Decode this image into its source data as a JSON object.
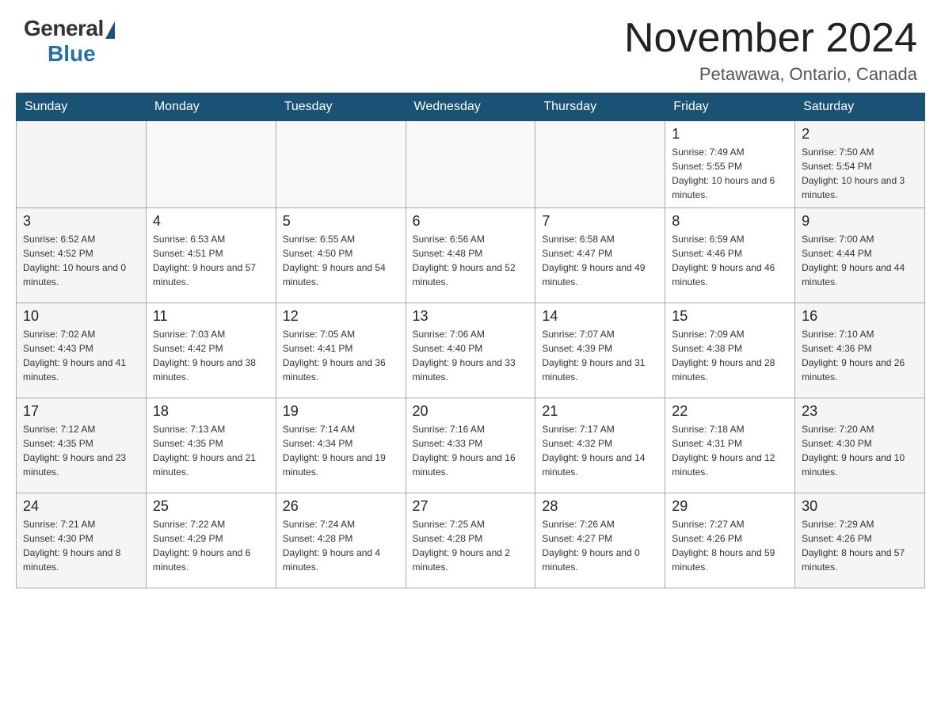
{
  "header": {
    "logo_general": "General",
    "logo_blue": "Blue",
    "month_title": "November 2024",
    "location": "Petawawa, Ontario, Canada"
  },
  "weekdays": [
    "Sunday",
    "Monday",
    "Tuesday",
    "Wednesday",
    "Thursday",
    "Friday",
    "Saturday"
  ],
  "weeks": [
    [
      {
        "day": "",
        "info": ""
      },
      {
        "day": "",
        "info": ""
      },
      {
        "day": "",
        "info": ""
      },
      {
        "day": "",
        "info": ""
      },
      {
        "day": "",
        "info": ""
      },
      {
        "day": "1",
        "info": "Sunrise: 7:49 AM\nSunset: 5:55 PM\nDaylight: 10 hours and 6 minutes."
      },
      {
        "day": "2",
        "info": "Sunrise: 7:50 AM\nSunset: 5:54 PM\nDaylight: 10 hours and 3 minutes."
      }
    ],
    [
      {
        "day": "3",
        "info": "Sunrise: 6:52 AM\nSunset: 4:52 PM\nDaylight: 10 hours and 0 minutes."
      },
      {
        "day": "4",
        "info": "Sunrise: 6:53 AM\nSunset: 4:51 PM\nDaylight: 9 hours and 57 minutes."
      },
      {
        "day": "5",
        "info": "Sunrise: 6:55 AM\nSunset: 4:50 PM\nDaylight: 9 hours and 54 minutes."
      },
      {
        "day": "6",
        "info": "Sunrise: 6:56 AM\nSunset: 4:48 PM\nDaylight: 9 hours and 52 minutes."
      },
      {
        "day": "7",
        "info": "Sunrise: 6:58 AM\nSunset: 4:47 PM\nDaylight: 9 hours and 49 minutes."
      },
      {
        "day": "8",
        "info": "Sunrise: 6:59 AM\nSunset: 4:46 PM\nDaylight: 9 hours and 46 minutes."
      },
      {
        "day": "9",
        "info": "Sunrise: 7:00 AM\nSunset: 4:44 PM\nDaylight: 9 hours and 44 minutes."
      }
    ],
    [
      {
        "day": "10",
        "info": "Sunrise: 7:02 AM\nSunset: 4:43 PM\nDaylight: 9 hours and 41 minutes."
      },
      {
        "day": "11",
        "info": "Sunrise: 7:03 AM\nSunset: 4:42 PM\nDaylight: 9 hours and 38 minutes."
      },
      {
        "day": "12",
        "info": "Sunrise: 7:05 AM\nSunset: 4:41 PM\nDaylight: 9 hours and 36 minutes."
      },
      {
        "day": "13",
        "info": "Sunrise: 7:06 AM\nSunset: 4:40 PM\nDaylight: 9 hours and 33 minutes."
      },
      {
        "day": "14",
        "info": "Sunrise: 7:07 AM\nSunset: 4:39 PM\nDaylight: 9 hours and 31 minutes."
      },
      {
        "day": "15",
        "info": "Sunrise: 7:09 AM\nSunset: 4:38 PM\nDaylight: 9 hours and 28 minutes."
      },
      {
        "day": "16",
        "info": "Sunrise: 7:10 AM\nSunset: 4:36 PM\nDaylight: 9 hours and 26 minutes."
      }
    ],
    [
      {
        "day": "17",
        "info": "Sunrise: 7:12 AM\nSunset: 4:35 PM\nDaylight: 9 hours and 23 minutes."
      },
      {
        "day": "18",
        "info": "Sunrise: 7:13 AM\nSunset: 4:35 PM\nDaylight: 9 hours and 21 minutes."
      },
      {
        "day": "19",
        "info": "Sunrise: 7:14 AM\nSunset: 4:34 PM\nDaylight: 9 hours and 19 minutes."
      },
      {
        "day": "20",
        "info": "Sunrise: 7:16 AM\nSunset: 4:33 PM\nDaylight: 9 hours and 16 minutes."
      },
      {
        "day": "21",
        "info": "Sunrise: 7:17 AM\nSunset: 4:32 PM\nDaylight: 9 hours and 14 minutes."
      },
      {
        "day": "22",
        "info": "Sunrise: 7:18 AM\nSunset: 4:31 PM\nDaylight: 9 hours and 12 minutes."
      },
      {
        "day": "23",
        "info": "Sunrise: 7:20 AM\nSunset: 4:30 PM\nDaylight: 9 hours and 10 minutes."
      }
    ],
    [
      {
        "day": "24",
        "info": "Sunrise: 7:21 AM\nSunset: 4:30 PM\nDaylight: 9 hours and 8 minutes."
      },
      {
        "day": "25",
        "info": "Sunrise: 7:22 AM\nSunset: 4:29 PM\nDaylight: 9 hours and 6 minutes."
      },
      {
        "day": "26",
        "info": "Sunrise: 7:24 AM\nSunset: 4:28 PM\nDaylight: 9 hours and 4 minutes."
      },
      {
        "day": "27",
        "info": "Sunrise: 7:25 AM\nSunset: 4:28 PM\nDaylight: 9 hours and 2 minutes."
      },
      {
        "day": "28",
        "info": "Sunrise: 7:26 AM\nSunset: 4:27 PM\nDaylight: 9 hours and 0 minutes."
      },
      {
        "day": "29",
        "info": "Sunrise: 7:27 AM\nSunset: 4:26 PM\nDaylight: 8 hours and 59 minutes."
      },
      {
        "day": "30",
        "info": "Sunrise: 7:29 AM\nSunset: 4:26 PM\nDaylight: 8 hours and 57 minutes."
      }
    ]
  ]
}
